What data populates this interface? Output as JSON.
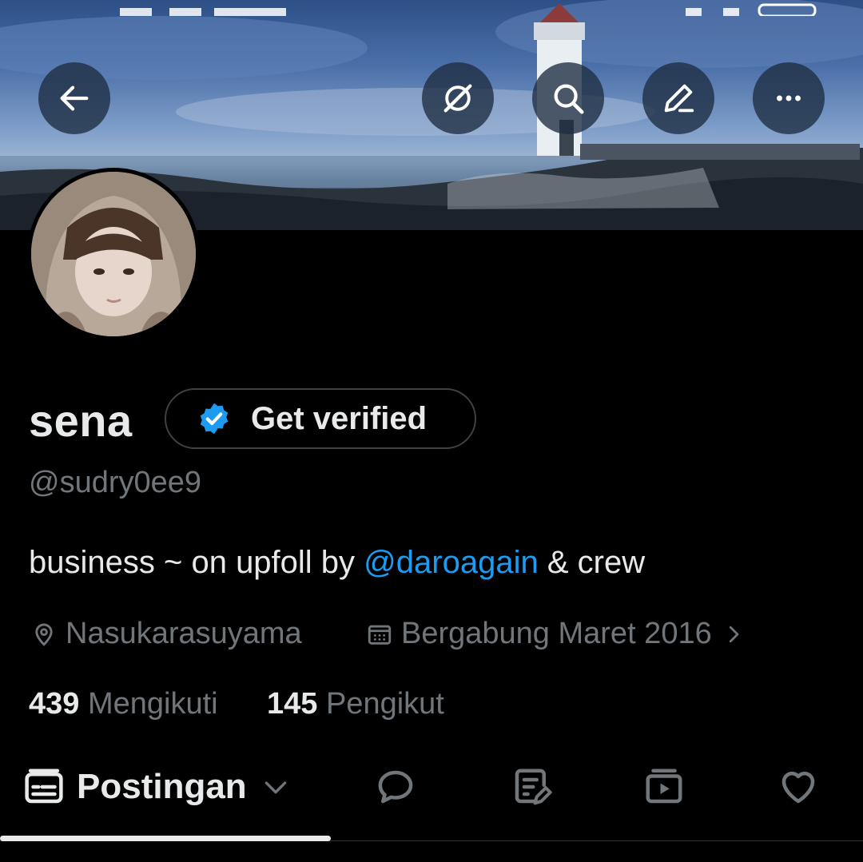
{
  "header": {
    "buttons": [
      {
        "name": "back-button",
        "icon": "arrow-left-icon"
      },
      {
        "name": "grok-button",
        "icon": "grok-icon"
      },
      {
        "name": "search-button",
        "icon": "search-icon"
      },
      {
        "name": "edit-button",
        "icon": "pencil-icon"
      },
      {
        "name": "more-button",
        "icon": "more-horizontal-icon"
      }
    ]
  },
  "profile": {
    "display_name": "sena",
    "verify_label": "Get verified",
    "handle": "@sudry0ee9",
    "bio_prefix": "business ~ on upfoll by ",
    "bio_mention": "@daroagain",
    "bio_suffix": " & crew",
    "location": "Nasukarasuyama",
    "joined": "Bergabung Maret 2016",
    "following_count": "439",
    "following_label": "Mengikuti",
    "followers_count": "145",
    "followers_label": "Pengikut"
  },
  "tabs": {
    "active_label": "Postingan",
    "items": [
      "posts-tab",
      "replies-tab",
      "articles-tab",
      "media-tab",
      "likes-tab"
    ]
  },
  "colors": {
    "background": "#000000",
    "text_primary": "#e7e9ea",
    "text_secondary": "#71767b",
    "accent": "#1d9bf0",
    "border": "#3e4144"
  }
}
